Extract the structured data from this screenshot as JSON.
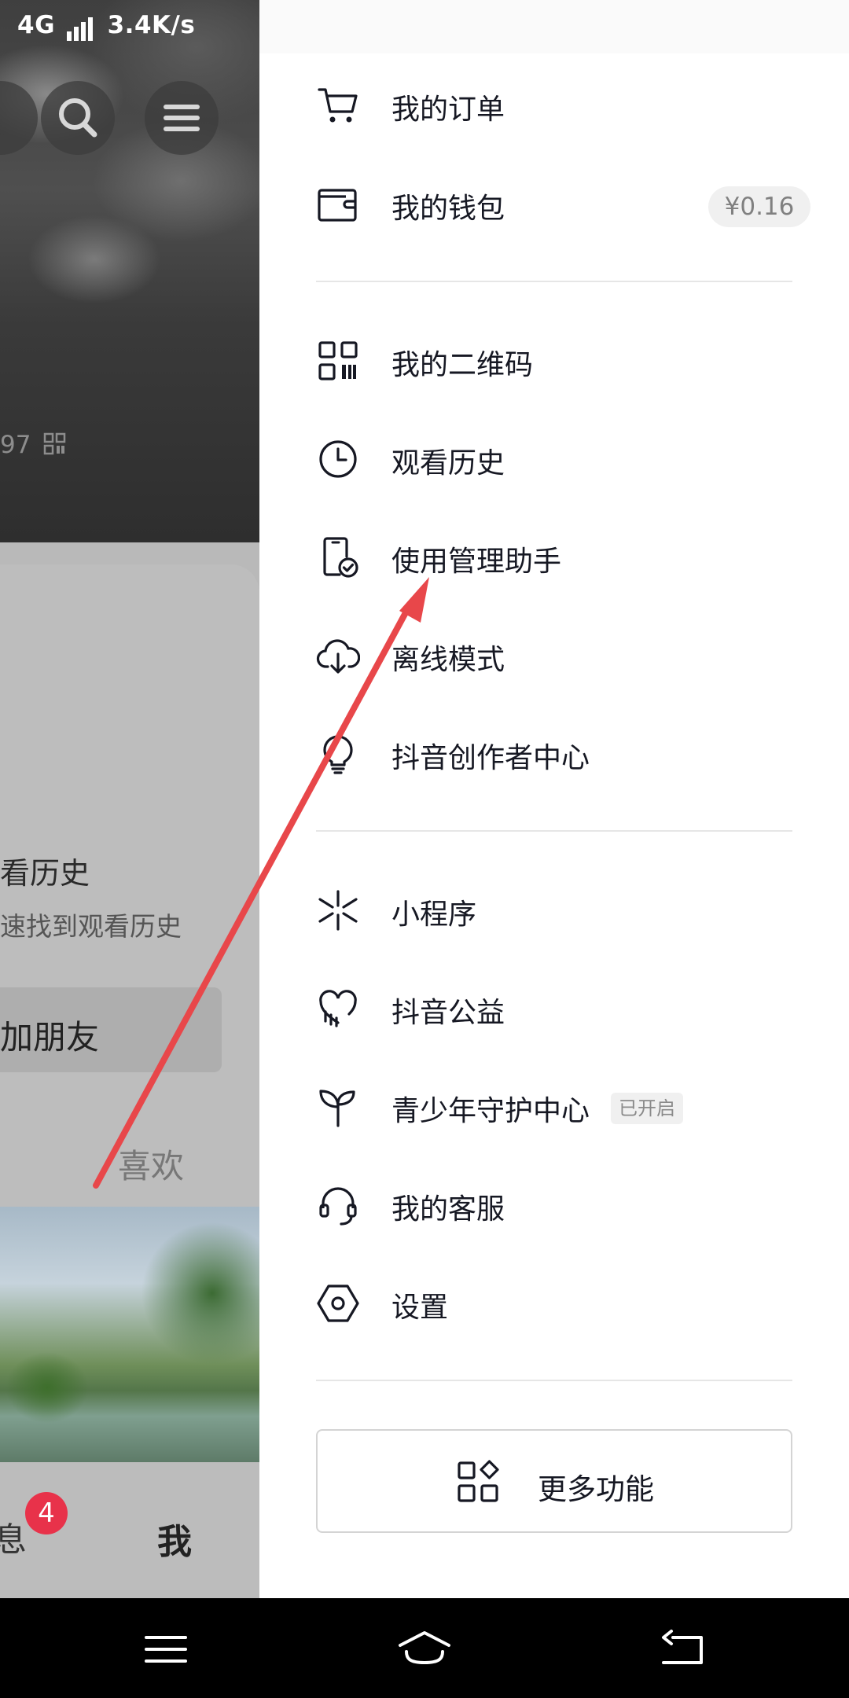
{
  "status_bar": {
    "network": "4G",
    "speed": "3.4K/s"
  },
  "background_page": {
    "uid_fragment": "97",
    "history_title": "看历史",
    "history_subtitle": "速找到观看历史",
    "add_friend": "加朋友",
    "likes_tab": "喜欢",
    "nav_messages": "息",
    "messages_badge": "4",
    "nav_me": "我"
  },
  "drawer": {
    "items": [
      {
        "label": "我的订单",
        "icon": "cart-icon"
      },
      {
        "label": "我的钱包",
        "icon": "wallet-icon",
        "badge": "¥0.16"
      },
      {
        "label": "我的二维码",
        "icon": "qrcode-icon"
      },
      {
        "label": "观看历史",
        "icon": "clock-icon"
      },
      {
        "label": "使用管理助手",
        "icon": "phone-check-icon"
      },
      {
        "label": "离线模式",
        "icon": "cloud-download-icon"
      },
      {
        "label": "抖音创作者中心",
        "icon": "lightbulb-icon"
      },
      {
        "label": "小程序",
        "icon": "mini-program-icon"
      },
      {
        "label": "抖音公益",
        "icon": "heart-hand-icon"
      },
      {
        "label": "青少年守护中心",
        "icon": "sprout-icon",
        "tag": "已开启"
      },
      {
        "label": "我的客服",
        "icon": "headset-icon"
      },
      {
        "label": "设置",
        "icon": "settings-hex-icon"
      }
    ],
    "more_button": "更多功能"
  },
  "annotation": {
    "arrow_color": "#e8474a"
  },
  "colors": {
    "text": "#161823",
    "divider": "#e6e6e6",
    "badge": "#e8324a"
  }
}
